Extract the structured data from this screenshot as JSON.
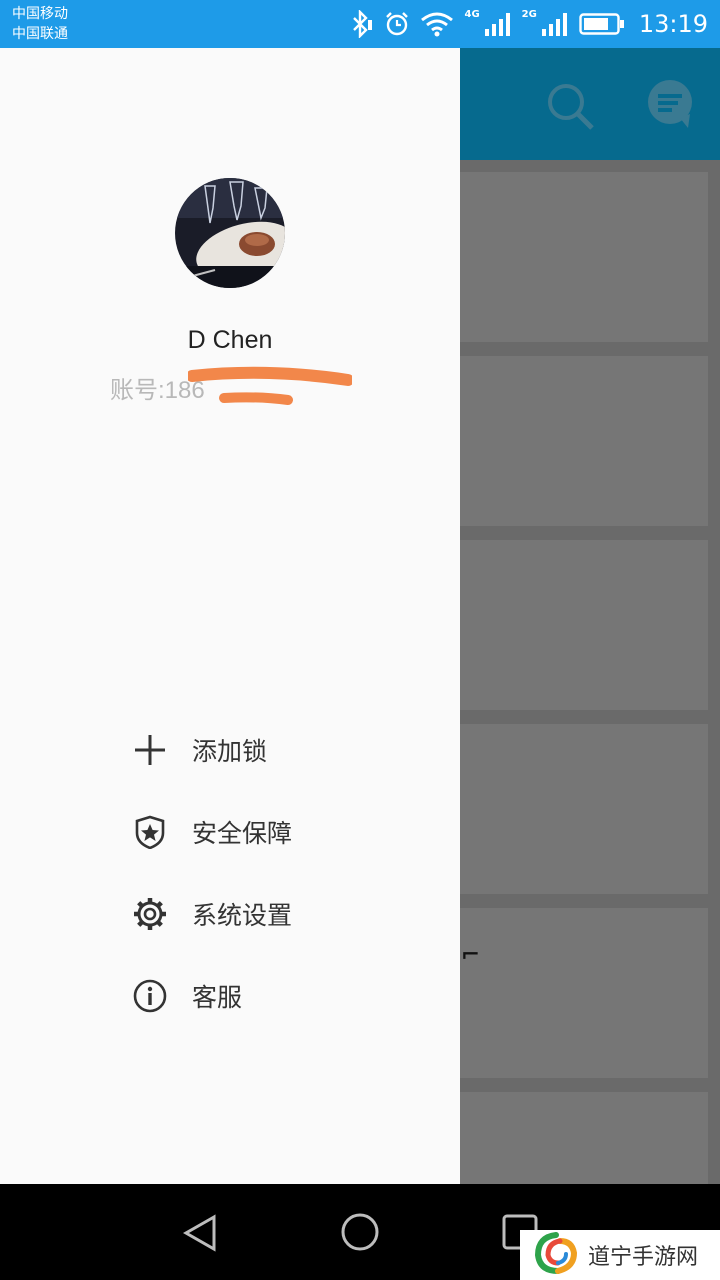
{
  "status_bar": {
    "carrier_1": "中国移动",
    "carrier_2": "中国联通",
    "network_1": "4G",
    "network_2": "2G",
    "time": "13:19"
  },
  "drawer": {
    "user_name": "D Chen",
    "account_label": "账号:186",
    "menu": [
      {
        "label": "添加锁",
        "icon": "plus-icon"
      },
      {
        "label": "安全保障",
        "icon": "shield-star-icon"
      },
      {
        "label": "系统设置",
        "icon": "gear-icon"
      },
      {
        "label": "客服",
        "icon": "info-icon"
      }
    ]
  },
  "watermark": {
    "text": "道宁手游网"
  },
  "colors": {
    "status_bar": "#1e9be8",
    "toolbar_dimmed": "#066a8e",
    "drawer_bg": "#fafafa",
    "redaction": "#f2874a"
  }
}
